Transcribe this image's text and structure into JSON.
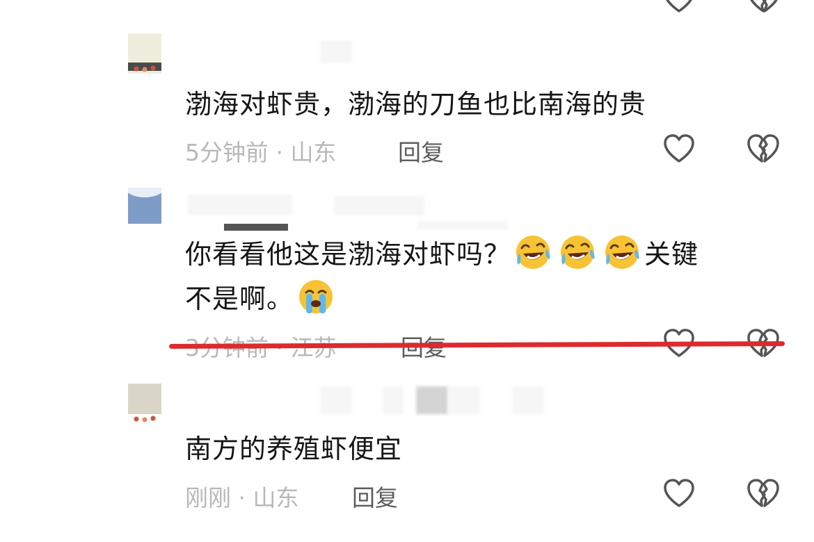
{
  "comments": [
    {
      "text": "渤海对虾贵，渤海的刀鱼也比南海的贵",
      "time": "5分钟前",
      "location": "山东",
      "reply": "回复",
      "like_icon": "heart-outline-icon",
      "dislike_icon": "broken-heart-icon"
    },
    {
      "text_line1": "你看看他这是渤海对虾吗？",
      "text_line1_tail": "关键",
      "text_line2": "不是啊。",
      "emoji_1": "rolling-laughing-emoji",
      "emoji_2": "loudly-crying-emoji",
      "time": "3分钟前",
      "location": "江苏",
      "reply": "回复",
      "like_icon": "heart-outline-icon",
      "dislike_icon": "broken-heart-icon"
    },
    {
      "text": "南方的养殖虾便宜",
      "time": "刚刚",
      "location": "山东",
      "reply": "回复",
      "like_icon": "heart-outline-icon",
      "dislike_icon": "broken-heart-icon"
    }
  ],
  "meta_separator": "·",
  "colors": {
    "comment_text": "#151515",
    "meta_text": "#b8b8b8",
    "reply_text": "#5c5c5c",
    "strike_line": "#dd2a2e",
    "icon_stroke": "#555555"
  }
}
